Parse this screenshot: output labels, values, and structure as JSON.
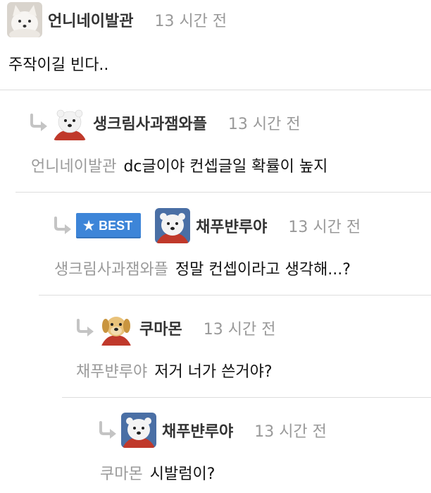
{
  "comments": [
    {
      "nickname": "언니네이발관",
      "time": "13 시간 전",
      "avatar_icon": "white-fox-avatar-icon",
      "text": "주작이길 빈다.."
    },
    {
      "nickname": "생크림사과잼와플",
      "time": "13 시간 전",
      "avatar_icon": "polar-bear-avatar-icon",
      "mention": "언니네이발관",
      "text": "dc글이야 컨셉글일 확률이 높지"
    },
    {
      "badge": "BEST",
      "nickname": "채푸뱐루야",
      "time": "13 시간 전",
      "avatar_icon": "polar-bear-avatar-icon",
      "mention": "생크림사과잼와플",
      "text": "정말 컨셉이라고 생각해...?"
    },
    {
      "nickname": "쿠마몬",
      "time": "13 시간 전",
      "avatar_icon": "puppy-avatar-icon",
      "mention": "채푸뱐루야",
      "text": "저거 너가 쓴거야?"
    },
    {
      "nickname": "채푸뱐루야",
      "time": "13 시간 전",
      "avatar_icon": "polar-bear-avatar-icon",
      "mention": "쿠마몬",
      "text": "시발럼이?"
    }
  ],
  "colors": {
    "best_badge": "#3d85d8",
    "mention_text": "#9a9a9a",
    "time_text": "#999999",
    "divider": "#dddddd"
  }
}
